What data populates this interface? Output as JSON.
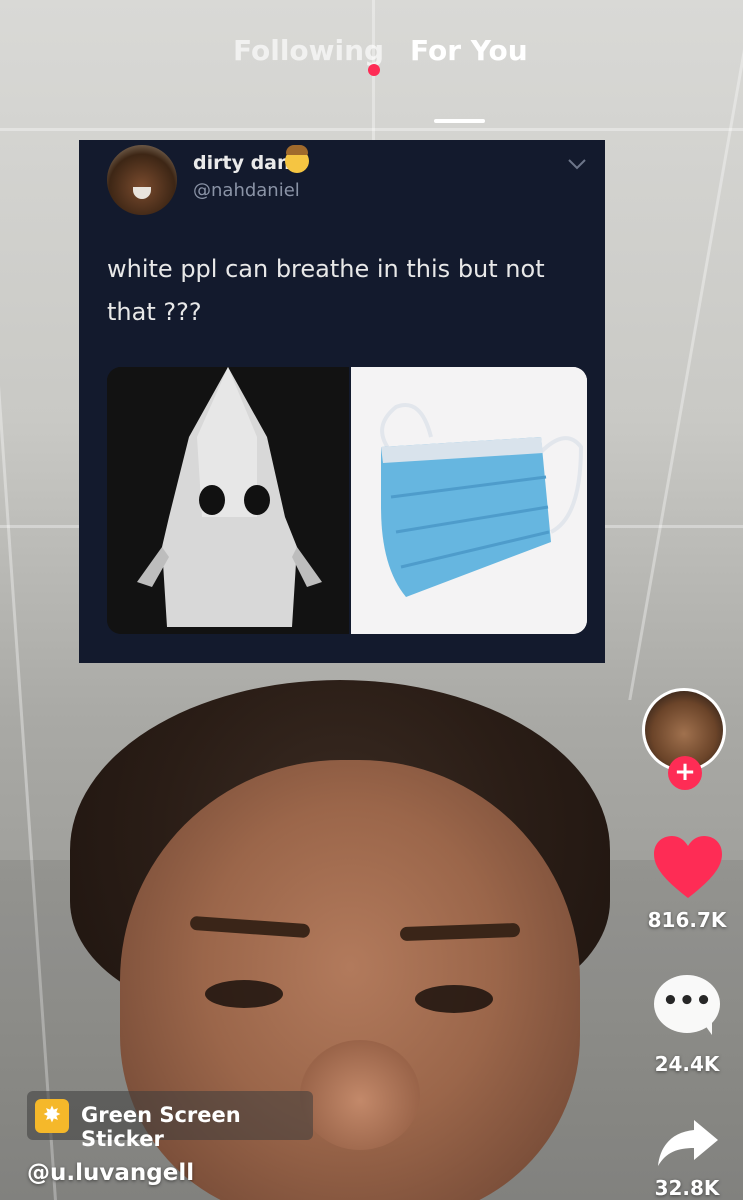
{
  "tabs": {
    "following_label": "Following",
    "for_you_label": "For You",
    "active": "For You"
  },
  "tweet": {
    "display_name": "dirty dan",
    "handle": "@nahdaniel",
    "text": "white ppl can breathe in this but not that ???",
    "chevron_icon": "chevron-down-icon"
  },
  "actions": {
    "likes": "816.7K",
    "comments": "24.4K",
    "shares": "32.8K",
    "follow_plus": "+"
  },
  "sticker": {
    "label": "Green Screen Sticker"
  },
  "author": {
    "username": "@u.luvangell"
  },
  "colors": {
    "accent": "#fe2c55",
    "tweet_bg": "#131a2d"
  }
}
